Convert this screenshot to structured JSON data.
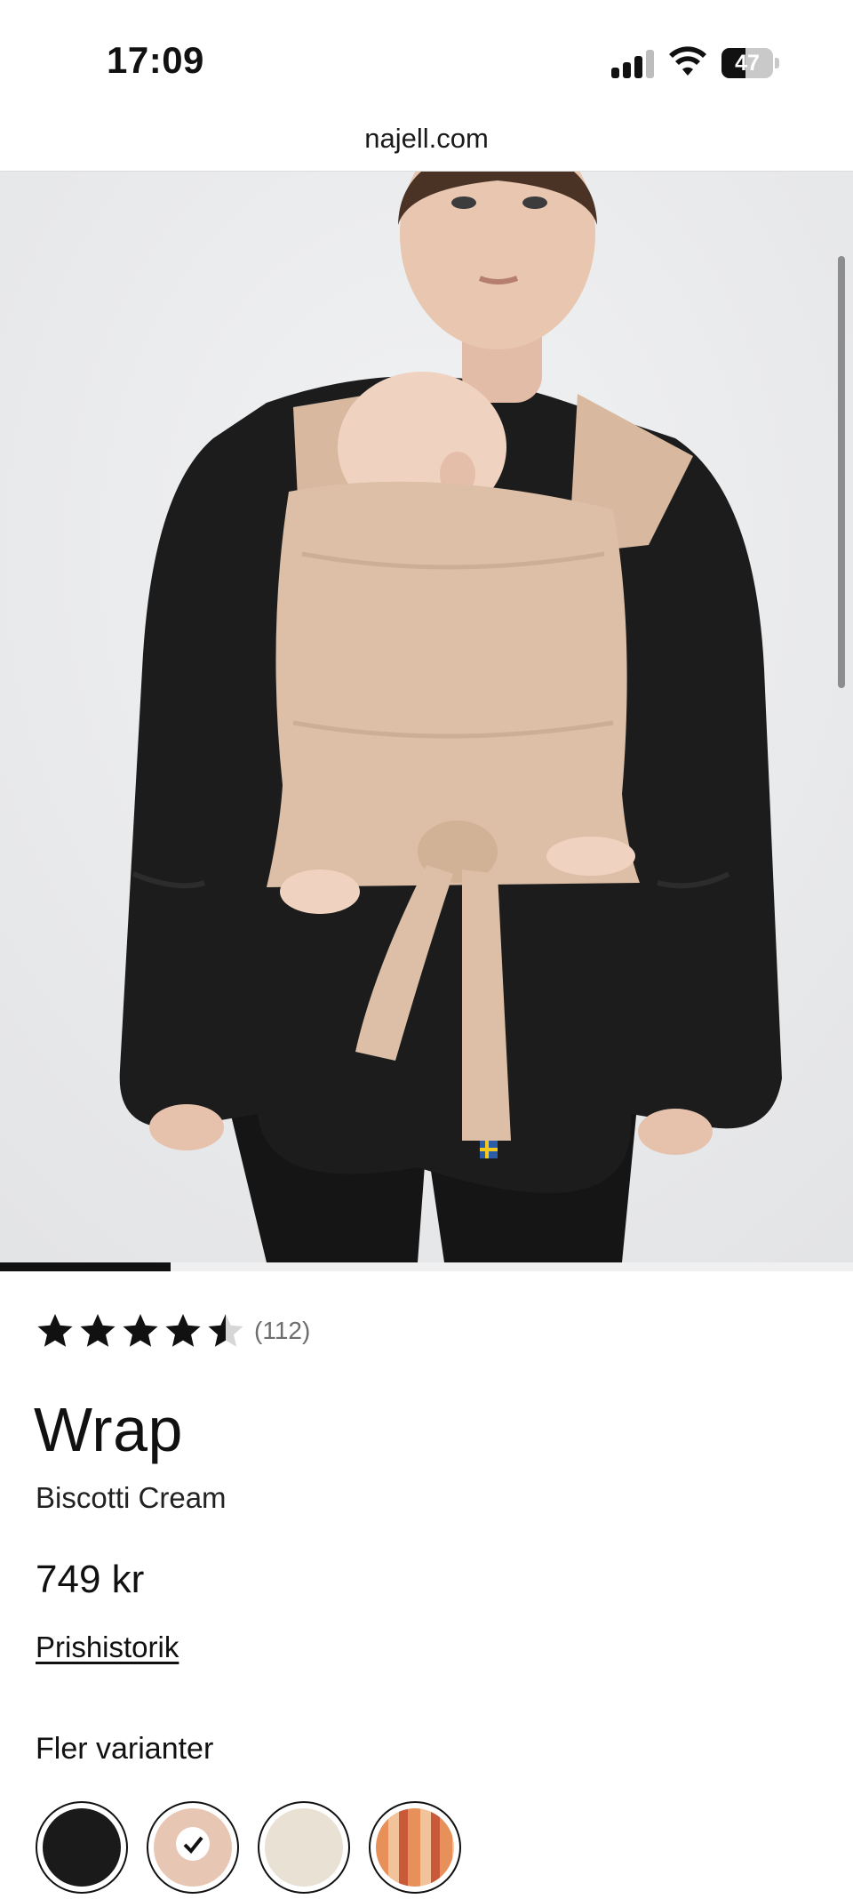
{
  "status_bar": {
    "time": "17:09",
    "battery_level": "47",
    "battery_fraction": 0.47,
    "icons": [
      "signal-icon",
      "wifi-icon",
      "battery-icon"
    ]
  },
  "browser": {
    "url": "najell.com"
  },
  "gallery": {
    "image_index": 1,
    "image_count": 5,
    "progress_fraction": 0.2
  },
  "product": {
    "rating_value": 4.5,
    "rating_max": 5,
    "review_count": "(112)",
    "title": "Wrap",
    "variant_name": "Biscotti Cream",
    "price": "749 kr",
    "price_history_link": "Prishistorik"
  },
  "variants": {
    "heading": "Fler varianter",
    "swatches": [
      {
        "color": "#1a1a1a",
        "selected": false
      },
      {
        "color": "#e7c6b4",
        "selected": true
      },
      {
        "color": "#e8e1d4",
        "selected": false
      },
      {
        "color": "#e8905a",
        "selected": false
      }
    ]
  },
  "colors": {
    "accent": "#111111",
    "wrap_fabric": "#dcbfa6",
    "shirt": "#1b1b1b",
    "background": "#e9eaec"
  }
}
